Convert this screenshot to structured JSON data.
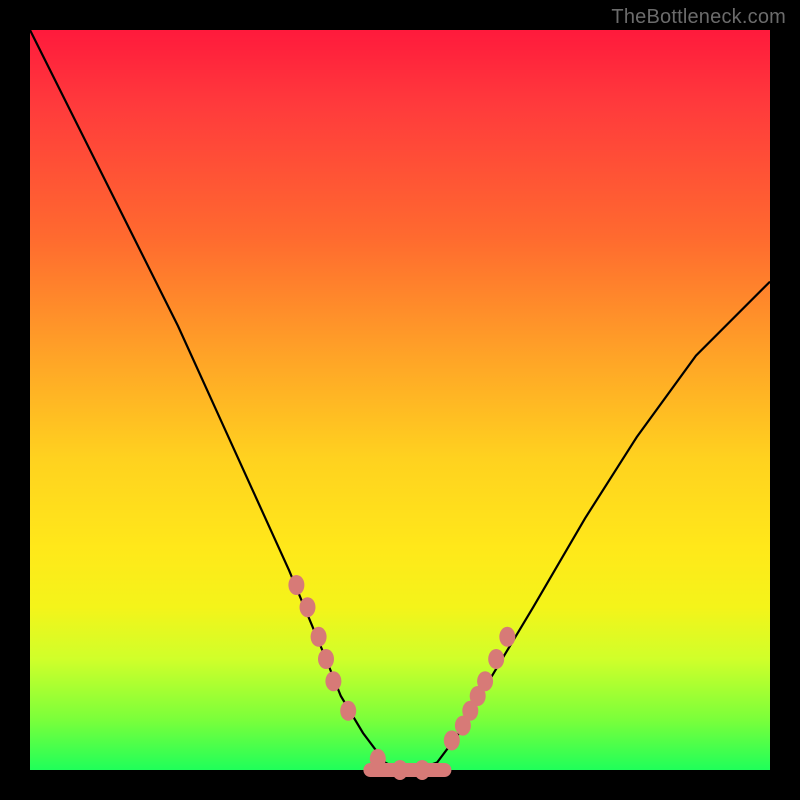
{
  "watermark": "TheBottleneck.com",
  "chart_data": {
    "type": "line",
    "title": "",
    "xlabel": "",
    "ylabel": "",
    "xlim": [
      0,
      100
    ],
    "ylim": [
      0,
      100
    ],
    "series": [
      {
        "name": "bottleneck-curve",
        "x": [
          0,
          5,
          10,
          15,
          20,
          25,
          30,
          35,
          40,
          42,
          45,
          48,
          50,
          52,
          55,
          58,
          62,
          68,
          75,
          82,
          90,
          100
        ],
        "y": [
          100,
          90,
          80,
          70,
          60,
          49,
          38,
          27,
          15,
          10,
          5,
          1,
          0,
          0,
          1,
          5,
          12,
          22,
          34,
          45,
          56,
          66
        ]
      }
    ],
    "markers": {
      "name": "highlight-dots",
      "color": "#d77a77",
      "x": [
        36,
        37.5,
        39,
        40,
        41,
        43,
        47,
        50,
        53,
        57,
        58.5,
        59.5,
        60.5,
        61.5,
        63,
        64.5
      ],
      "y": [
        25,
        22,
        18,
        15,
        12,
        8,
        1.5,
        0,
        0,
        4,
        6,
        8,
        10,
        12,
        15,
        18
      ]
    },
    "valley_segment": {
      "name": "valley-bar",
      "color": "#d77a77",
      "x": [
        46,
        56
      ],
      "y": [
        0,
        0
      ]
    }
  }
}
